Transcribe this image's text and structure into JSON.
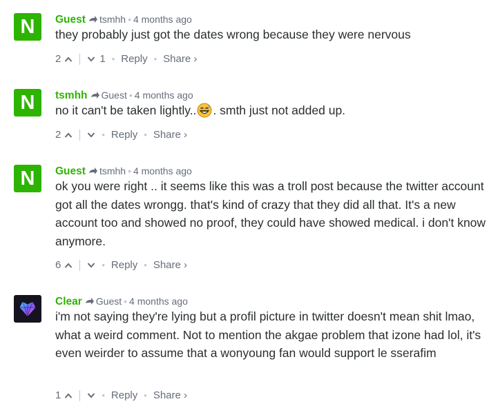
{
  "comments": [
    {
      "avatar_letter": "N",
      "author": "Guest",
      "reply_to": "tsmhh",
      "time": "4 months ago",
      "text": "they probably just got the dates wrong because they were nervous",
      "upvotes": "2",
      "downvotes": "1",
      "reply_label": "Reply",
      "share_label": "Share ›"
    },
    {
      "avatar_letter": "N",
      "author": "tsmhh",
      "reply_to": "Guest",
      "time": "4 months ago",
      "text_before": "no it can't be taken lightly..",
      "text_after": ". smth just not added up.",
      "upvotes": "2",
      "reply_label": "Reply",
      "share_label": "Share ›"
    },
    {
      "avatar_letter": "N",
      "author": "Guest",
      "reply_to": "tsmhh",
      "time": "4 months ago",
      "text": "ok you were right .. it seems like this was a troll post because the twitter account got all the dates wrongg. that's kind of crazy that they did all that. It's a new account too and showed no proof, they could have showed medical. i don't know anymore.",
      "upvotes": "6",
      "reply_label": "Reply",
      "share_label": "Share ›"
    },
    {
      "author": "Clear",
      "reply_to": "Guest",
      "time": "4 months ago",
      "text": "i'm not saying they're lying but a profil picture in twitter doesn't mean shit lmao, what a weird comment. Not to mention the akgae problem that izone had lol, it's even weirder to assume that a wonyoung fan would support le sserafim",
      "upvotes": "1",
      "reply_label": "Reply",
      "share_label": "Share ›"
    }
  ],
  "colors": {
    "author": "#2db400",
    "avatar_bg": "#2db400",
    "meta": "#656c7a",
    "text": "#2a2e2e"
  }
}
